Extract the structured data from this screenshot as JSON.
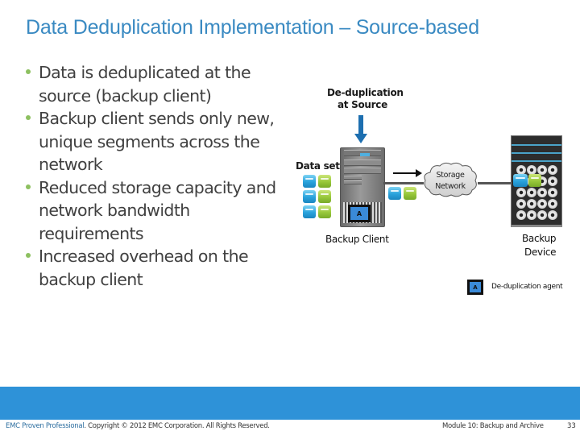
{
  "slide": {
    "title": "Data Deduplication Implementation – Source-based",
    "bullets": [
      "Data is deduplicated at the source (backup client)",
      "Backup client sends only new, unique segments across the network",
      "Reduced storage capacity and network bandwidth requirements",
      "Increased overhead on the backup client"
    ]
  },
  "diagram": {
    "dedup_label_line1": "De-duplication",
    "dedup_label_line2": "at Source",
    "dataset_label": "Data set",
    "client_label": "Backup Client",
    "network_label_line1": "Storage",
    "network_label_line2": "Network",
    "device_label_line1": "Backup",
    "device_label_line2": "Device",
    "agent_glyph": "A",
    "legend_glyph": "A",
    "legend_text": "De-duplication agent",
    "colors": {
      "cube_blue": "#2aa3dc",
      "cube_green": "#98c83b",
      "arrow_blue": "#1d6fb0",
      "agent_blue": "#3a8ad8"
    }
  },
  "footer": {
    "brand": "EMC Proven Professional",
    "copyright": ". Copyright © 2012 EMC Corporation. All Rights Reserved.",
    "module": "Module 10: Backup and Archive",
    "page": "33",
    "bar_color": "#2e92d8"
  }
}
